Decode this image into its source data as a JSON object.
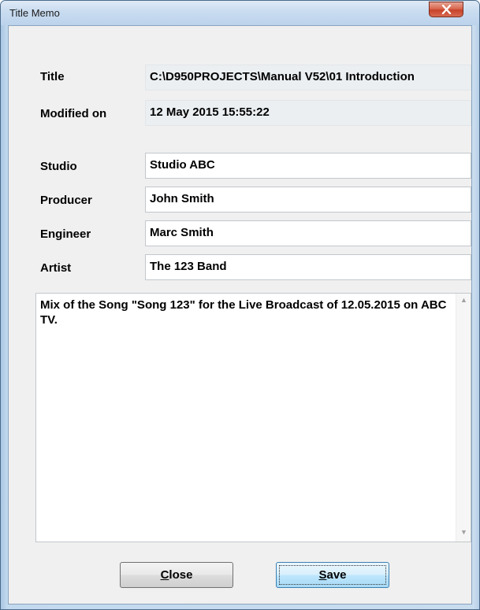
{
  "window": {
    "title": "Title Memo"
  },
  "fields": {
    "title_label": "Title",
    "title_value": "C:\\D950PROJECTS\\Manual V52\\01 Introduction",
    "modified_label": "Modified on",
    "modified_value": "12 May 2015  15:55:22",
    "studio_label": "Studio",
    "studio_value": "Studio ABC",
    "producer_label": "Producer",
    "producer_value": "John Smith",
    "engineer_label": "Engineer",
    "engineer_value": "Marc Smith",
    "artist_label": "Artist",
    "artist_value": "The 123 Band"
  },
  "memo": {
    "text": "Mix of the Song \"Song 123\" for the Live Broadcast of 12.05.2015 on ABC TV."
  },
  "buttons": {
    "close_mnemonic": "C",
    "close_rest": "lose",
    "save_mnemonic": "S",
    "save_rest": "ave"
  },
  "icons": {
    "window_close": "close-x-icon",
    "scroll_up": "scroll-up-arrow-icon",
    "scroll_down": "scroll-down-arrow-icon"
  }
}
